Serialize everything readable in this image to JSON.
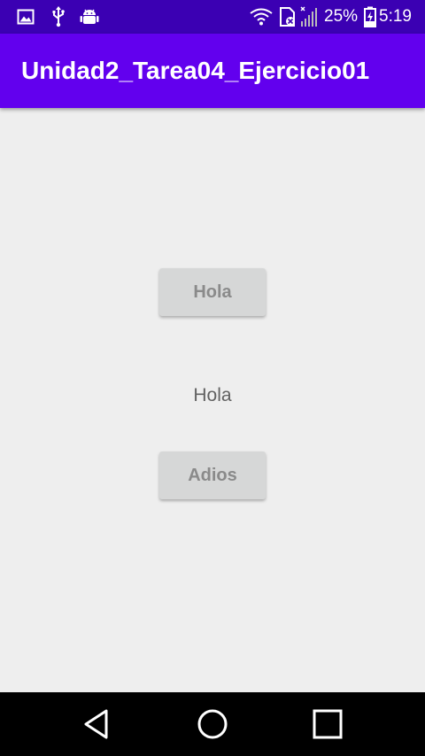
{
  "status_bar": {
    "battery_percent": "25%",
    "time": "5:19",
    "icons": [
      "image-icon",
      "usb-icon",
      "android-debug-icon",
      "wifi-icon",
      "sim-card-icon",
      "signal-icon",
      "battery-charging-icon"
    ]
  },
  "app_bar": {
    "title": "Unidad2_Tarea04_Ejercicio01"
  },
  "main": {
    "hola_button_label": "Hola",
    "message_text": "Hola",
    "adios_button_label": "Adios"
  },
  "nav_bar": {
    "icons": [
      "back-icon",
      "home-icon",
      "recents-icon"
    ]
  },
  "colors": {
    "status_bar": "#3b00b3",
    "app_bar": "#6200ee",
    "background": "#eeeeee",
    "button": "#d6d7d7",
    "button_text": "#8a8a8a",
    "message_text": "#616161"
  }
}
